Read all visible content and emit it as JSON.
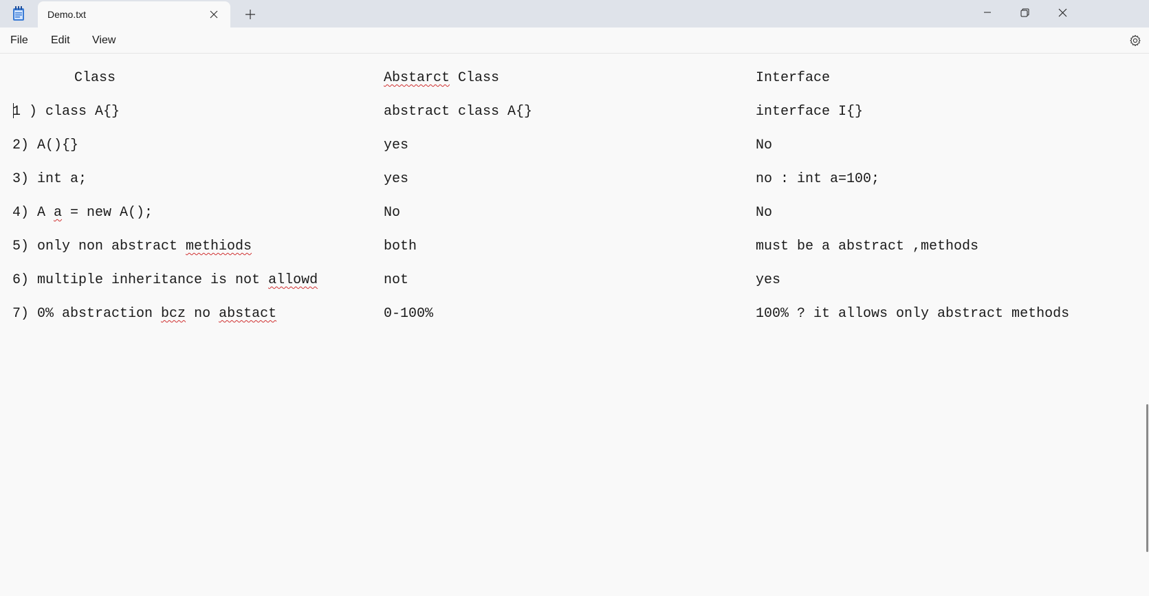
{
  "window": {
    "tab_title": "Demo.txt",
    "icons": {
      "app": "notepad-icon",
      "close_tab": "close-icon",
      "new_tab": "plus-icon",
      "minimize": "minimize-icon",
      "maximize": "restore-icon",
      "close": "close-icon"
    }
  },
  "menu": {
    "file": "File",
    "edit": "Edit",
    "view": "View",
    "settings_icon": "gear-icon"
  },
  "document": {
    "header": {
      "col1": "Class",
      "col2_a": "Abstarct",
      "col2_b": " Class",
      "col3": "Interface"
    },
    "rows": [
      {
        "c1": "1 ) class A{}",
        "c2": "abstract class A{}",
        "c3": "interface I{}"
      },
      {
        "c1": "2) A(){}",
        "c2": "yes",
        "c3": "No"
      },
      {
        "c1": "3) int a;",
        "c2": "yes",
        "c3": "no : int a=100;"
      },
      {
        "c1_a": "4) A ",
        "c1_b": "a",
        "c1_c": " = new A();",
        "c2": "No",
        "c3": "No"
      },
      {
        "c1_a": "5) only non abstract ",
        "c1_b": "methiods",
        "c2": "both",
        "c3": "must be a abstract ,methods"
      },
      {
        "c1_a": "6) multiple inheritance is not ",
        "c1_b": "allowd",
        "c2": "not",
        "c3": "yes"
      },
      {
        "c1_a": "7) 0% abstraction ",
        "c1_b": "bcz",
        "c1_c": " no ",
        "c1_d": "abstact",
        "c2": "0-100%",
        "c3": "100% ? it allows only abstract methods"
      }
    ]
  },
  "colors": {
    "titlebar": "#dfe3ea",
    "background": "#f9f9f9",
    "spellcheck": "#d03030",
    "app_icon": "#3a7bd5"
  }
}
